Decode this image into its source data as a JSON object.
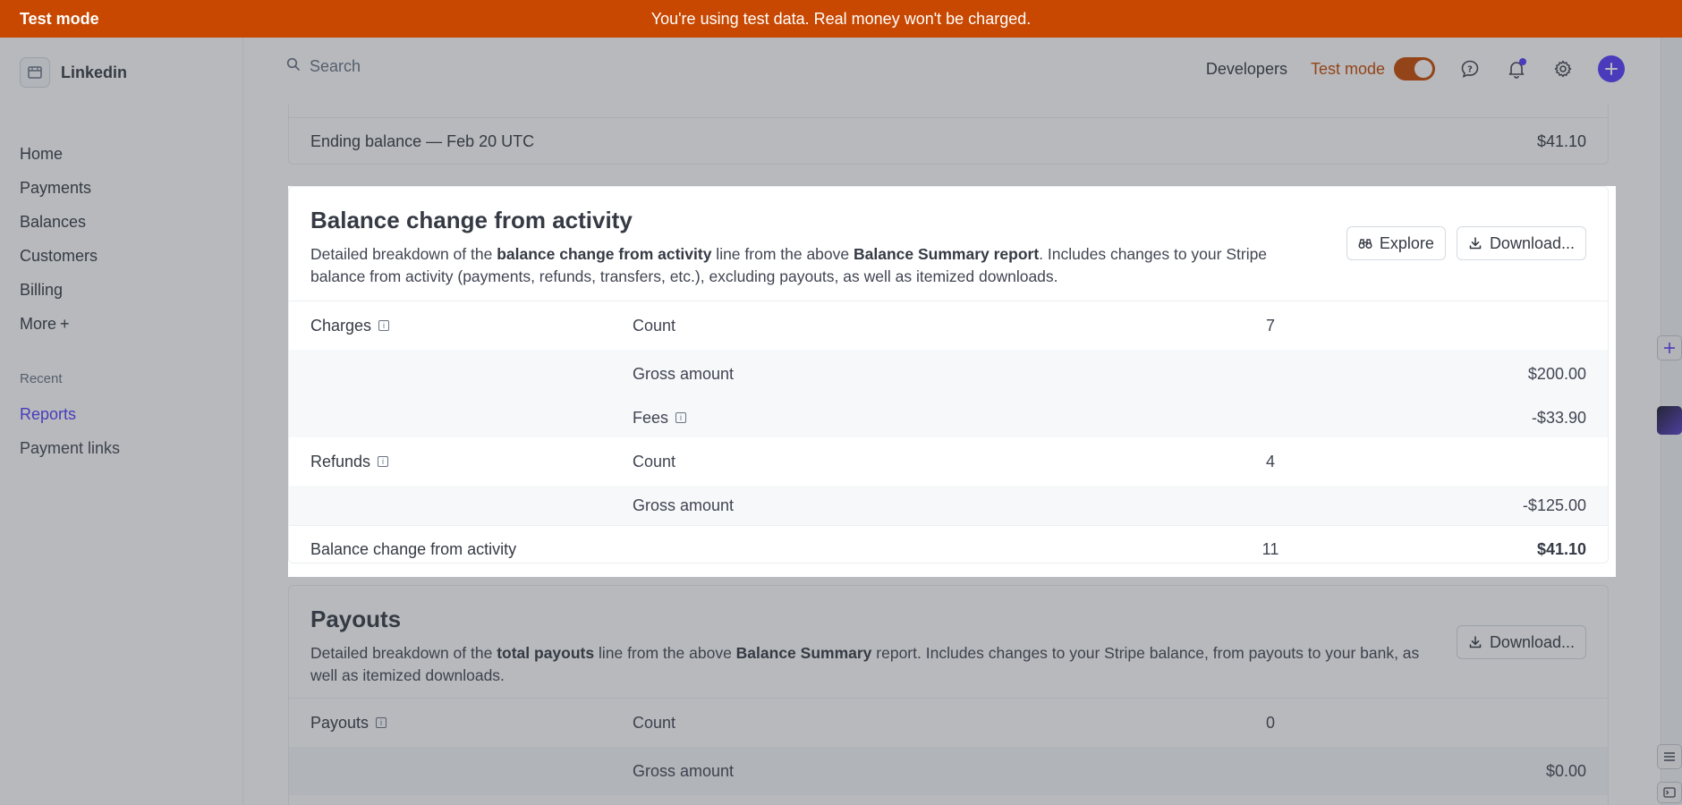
{
  "banner": {
    "label": "Test mode",
    "message": "You're using test data. Real money won't be charged."
  },
  "account": {
    "name": "Linkedin"
  },
  "nav": {
    "items": [
      "Home",
      "Payments",
      "Balances",
      "Customers",
      "Billing"
    ],
    "more_label": "More",
    "more_icon": "+",
    "recent_label": "Recent",
    "recent_items": [
      "Reports",
      "Payment links"
    ]
  },
  "header": {
    "search_placeholder": "Search",
    "developers_label": "Developers",
    "test_mode_label": "Test mode"
  },
  "ending_balance": {
    "label": "Ending balance — Feb 20 UTC",
    "amount": "$41.10"
  },
  "activity": {
    "title": "Balance change from activity",
    "desc": {
      "p1": "Detailed breakdown of the ",
      "b1": "balance change from activity",
      "p2": " line from the above ",
      "b2": "Balance Summary report",
      "p3": ". Includes changes to your Stripe balance from activity (payments, refunds, transfers, etc.), excluding payouts, as well as itemized downloads."
    },
    "explore_label": "Explore",
    "download_label": "Download...",
    "rows": {
      "charges_label": "Charges",
      "charges_count_label": "Count",
      "charges_count": "7",
      "charges_gross_label": "Gross amount",
      "charges_gross": "$200.00",
      "charges_fees_label": "Fees",
      "charges_fees": "-$33.90",
      "refunds_label": "Refunds",
      "refunds_count_label": "Count",
      "refunds_count": "4",
      "refunds_gross_label": "Gross amount",
      "refunds_gross": "-$125.00",
      "total_label": "Balance change from activity",
      "total_count": "11",
      "total_amount": "$41.10"
    }
  },
  "payouts": {
    "title": "Payouts",
    "desc": {
      "p1": "Detailed breakdown of the ",
      "b1": "total payouts",
      "p2": " line from the above ",
      "b2": "Balance Summary",
      "p3": " report. Includes changes to your Stripe balance, from payouts to your bank, as well as itemized downloads."
    },
    "download_label": "Download...",
    "rows": {
      "payouts_label": "Payouts",
      "count_label": "Count",
      "count": "0",
      "gross_label": "Gross amount",
      "gross": "$0.00"
    }
  },
  "icons": {
    "search": "search-icon",
    "help": "help-icon",
    "bell": "bell-icon",
    "gear": "gear-icon",
    "plus": "plus-icon",
    "download": "download-icon",
    "explore": "binoculars-icon",
    "info": "info-icon"
  },
  "colors": {
    "test_mode": "#c84801",
    "accent": "#533afd"
  }
}
